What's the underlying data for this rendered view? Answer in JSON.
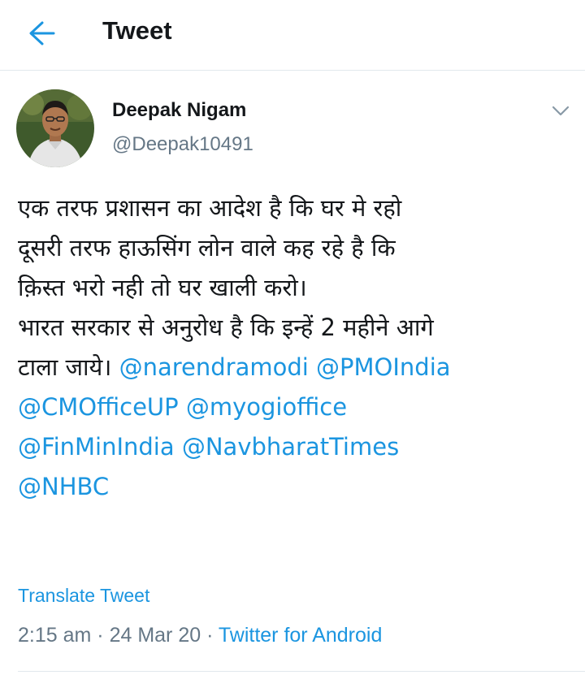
{
  "header": {
    "title": "Tweet",
    "back_icon": "arrow-left-icon"
  },
  "author": {
    "name": "Deepak Nigam",
    "handle": "@Deepak10491",
    "avatar": "profile-photo"
  },
  "tweet": {
    "lines": [
      "एक तरफ प्रशासन का आदेश है कि घर मे रहो",
      "दूसरी तरफ हाऊसिंग लोन वाले कह रहे है कि",
      "क़िस्त भरो नही तो घर खाली करो।",
      "भारत सरकार से अनुरोध है कि इन्हें 2 महीने आगे"
    ],
    "line5_text": "टाला जाये। ",
    "mentions": [
      "@narendramodi",
      "@PMOIndia",
      "@CMOfficeUP",
      "@myogioffice",
      "@FinMinIndia",
      "@NavbharatTimes",
      "@NHBC"
    ]
  },
  "translate_label": "Translate Tweet",
  "meta": {
    "time": "2:15 am",
    "sep1": " · ",
    "date": "24 Mar 20",
    "sep2": " · ",
    "source": "Twitter for Android"
  },
  "colors": {
    "link": "#1b95e0",
    "muted": "#657786",
    "text": "#14171a",
    "divider": "#e1e8ed"
  },
  "icons": {
    "caret": "chevron-down-icon"
  }
}
